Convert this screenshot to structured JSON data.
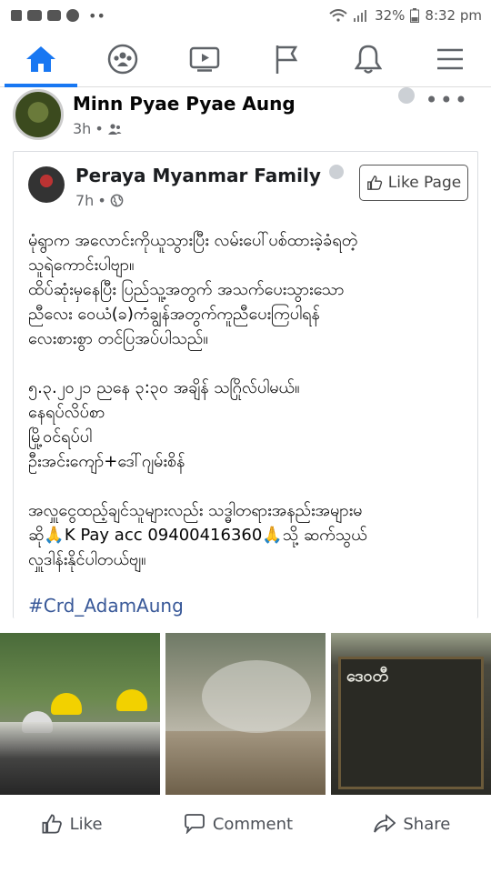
{
  "status_bar": {
    "battery": "32%",
    "time": "8:32 pm"
  },
  "nav": {
    "tabs": [
      "home",
      "groups",
      "watch",
      "pages",
      "notifications",
      "menu"
    ],
    "active": "home",
    "accent": "#1877f2"
  },
  "post": {
    "author": "Minn Pyae Pyae Aung",
    "time": "3h",
    "audience_icon": "friends-icon"
  },
  "shared": {
    "author": "Peraya Myanmar Family",
    "time": "7h",
    "audience_icon": "globe-icon",
    "like_page_label": "Like Page",
    "body_1": "မုံရွာက အလောင်းကိုယူသွားပြီး လမ်းပေါ်ပစ်ထားခဲ့ခံရတဲ့\nသူရဲကောင်းပါဗျာ။\nထိပ်ဆုံးမှနေပြီး ပြည်သူ့အတွက် အသက်ပေးသွားသော\nညီလေး ဝေယံ(ခ)ကံချွန်အတွက်ကူညီပေးကြပါရန်\nလေးစားစွာ တင်ပြအပ်ပါသည်။",
    "body_2": "၅.၃.၂၀၂၁ ညနေ ၃:၃၀ အချိန် သဂြိုလ်ပါမယ်။\nနေရပ်လိပ်စာ\nမြို့ဝင်ရပ်ပါ\nဦးအင်းကျော်+ဒေါ်ဂျမ်းစိန်",
    "body_3": "အလှူငွေထည့်ချင်သူများလည်း သဒ္ဓါတရားအနည်းအများမ\nဆို🙏K Pay acc 09400416360🙏သို့ ဆက်သွယ်\nလှူဒါန်းနိုင်ပါတယ်ဗျ။",
    "hashtag": "#Crd_AdamAung",
    "photo_board_text": "ဒေဝတီ"
  },
  "actions": {
    "like": "Like",
    "comment": "Comment",
    "share": "Share"
  }
}
